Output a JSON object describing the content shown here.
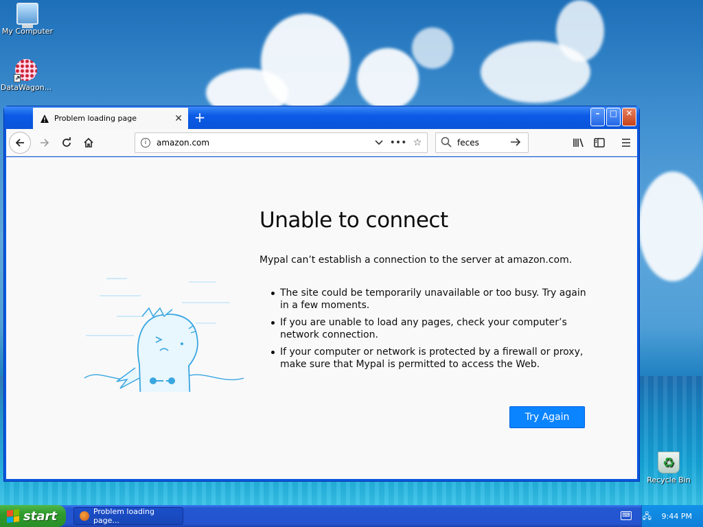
{
  "desktop": {
    "icons": [
      {
        "label": "My Computer",
        "icon": "computer-icon"
      },
      {
        "label": "DataWagon...",
        "icon": "datawagon-icon"
      },
      {
        "label": "Recycle Bin",
        "icon": "recycle-bin-icon"
      }
    ]
  },
  "browser": {
    "tab": {
      "title": "Problem loading page",
      "icon": "warning-icon",
      "close": "✕"
    },
    "new_tab": "+",
    "window_buttons": {
      "minimize": "–",
      "maximize": "□",
      "close": "✕"
    },
    "toolbar": {
      "url": "amazon.com",
      "search_value": "feces"
    },
    "error": {
      "title": "Unable to connect",
      "description": "Mypal can’t establish a connection to the server at amazon.com.",
      "reasons": [
        "The site could be temporarily unavailable or too busy. Try again in a few moments.",
        "If you are unable to load any pages, check your computer’s network connection.",
        "If your computer or network is protected by a firewall or proxy, make sure that Mypal is permitted to access the Web."
      ],
      "button": "Try Again"
    }
  },
  "taskbar": {
    "start_label": "start",
    "task_label": "Problem loading page...",
    "clock": "9:44 PM"
  },
  "colors": {
    "accent": "#0a84ff",
    "titlebar": "#0a58e0",
    "start_green": "#2f9b2c"
  }
}
